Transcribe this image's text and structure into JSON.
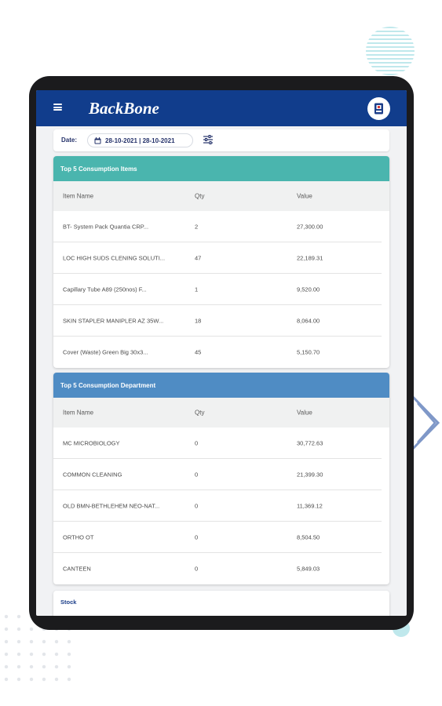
{
  "app": {
    "logo_text": "BackBone"
  },
  "date_filter": {
    "label": "Date:",
    "range": "28-10-2021 | 28-10-2021"
  },
  "sections": [
    {
      "title": "Top 5 Consumption Items",
      "header_color": "#4ab5ae",
      "columns": [
        "Item Name",
        "Qty",
        "Value"
      ],
      "rows": [
        [
          "BT- System Pack Quantia CRP...",
          "2",
          "27,300.00"
        ],
        [
          "LOC HIGH SUDS CLENING SOLUTI...",
          "47",
          "22,189.31"
        ],
        [
          "Capillary Tube A89 (250nos) F...",
          "1",
          "9,520.00"
        ],
        [
          "SKIN STAPLER MANIPLER AZ 35W...",
          "18",
          "8,064.00"
        ],
        [
          "Cover (Waste) Green Big 30x3...",
          "45",
          "5,150.70"
        ]
      ]
    },
    {
      "title": "Top 5 Consumption Department",
      "header_color": "#4f8cc4",
      "columns": [
        "Item Name",
        "Qty",
        "Value"
      ],
      "rows": [
        [
          "MC MICROBIOLOGY",
          "0",
          "30,772.63"
        ],
        [
          "COMMON CLEANING",
          "0",
          "21,399.30"
        ],
        [
          "OLD BMN-BETHLEHEM NEO-NAT...",
          "0",
          "11,369.12"
        ],
        [
          "ORTHO OT",
          "0",
          "8,504.50"
        ],
        [
          "CANTEEN",
          "0",
          "5,849.03"
        ]
      ]
    }
  ],
  "stock": {
    "label": "Stock"
  },
  "icons": {
    "menu": "menu-icon",
    "avatar": "user-badge-icon",
    "calendar": "calendar-icon",
    "filter": "filter-sliders-icon"
  }
}
